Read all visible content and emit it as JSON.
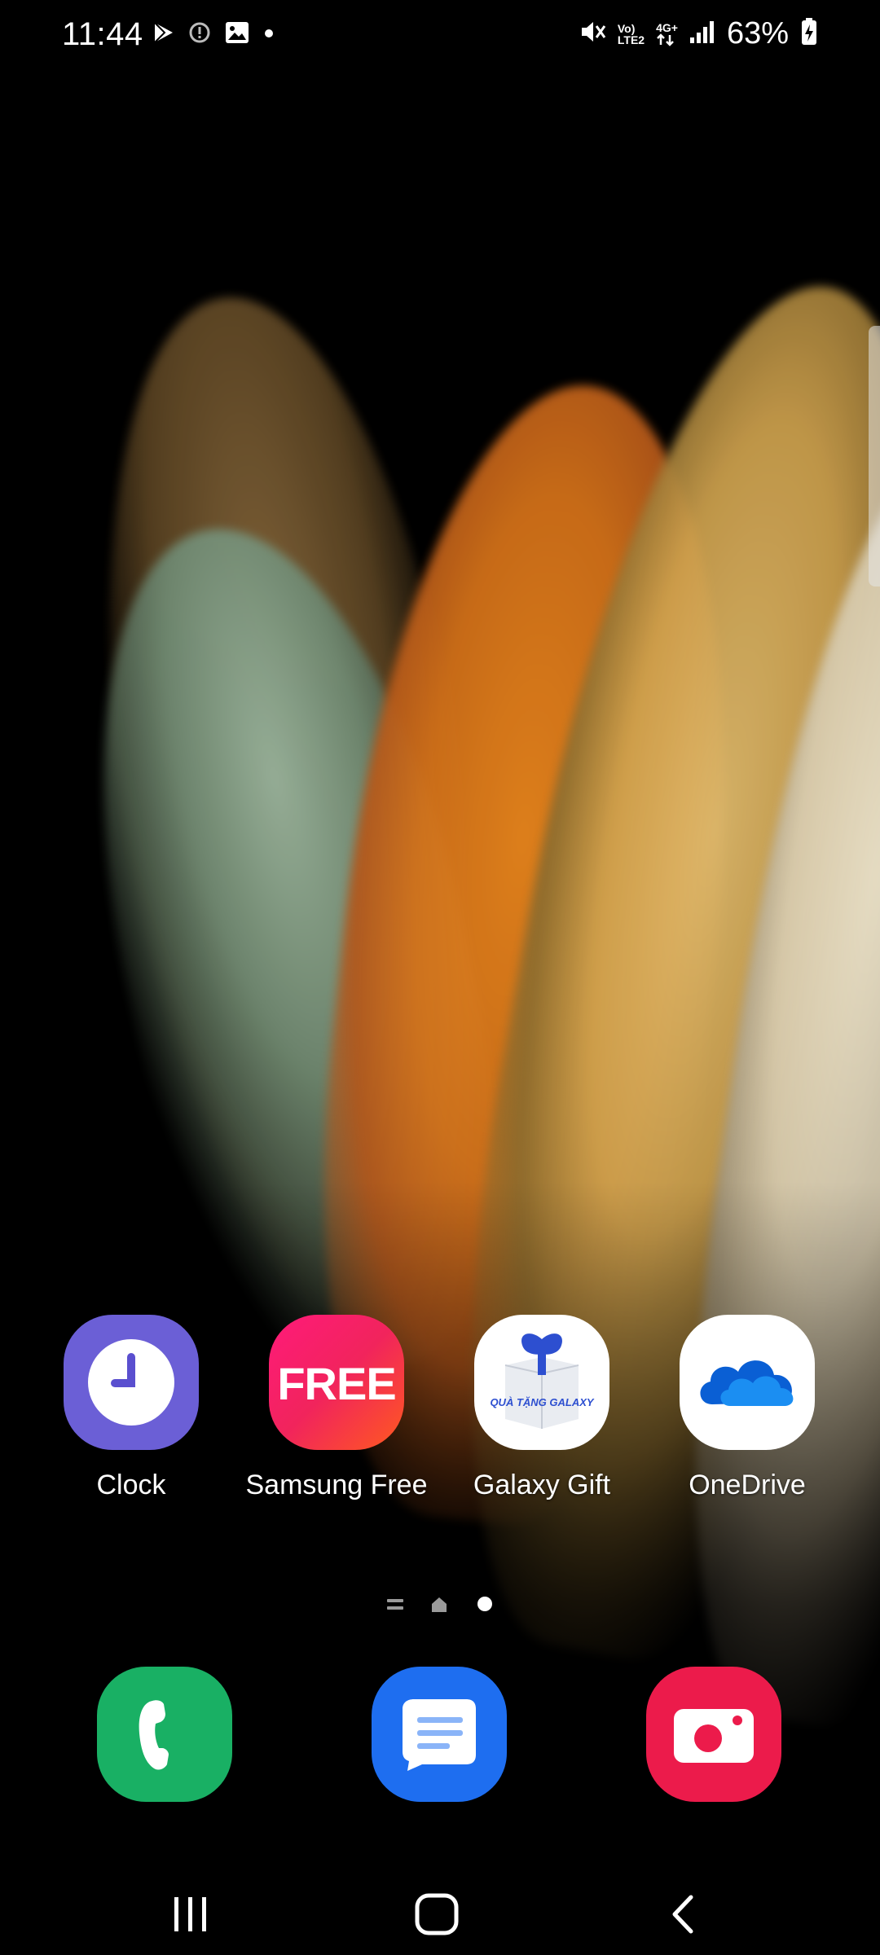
{
  "status_bar": {
    "time": "11:44",
    "notification_icons": [
      "play-store-icon",
      "alert-circle-icon",
      "image-icon",
      "dot-icon"
    ],
    "signal_label_top": "Vo)",
    "signal_label_bottom": "LTE2",
    "network_label": "4G+",
    "battery_percent": "63%",
    "status_icons": [
      "mute-icon",
      "volte-icon",
      "data-arrows-icon",
      "signal-bars-icon",
      "battery-charging-icon"
    ]
  },
  "home": {
    "apps": [
      {
        "label": "Clock",
        "icon": "clock-icon",
        "color": "#6b5fd6"
      },
      {
        "label": "Samsung Free",
        "icon": "samsung-free-icon",
        "color": "#f1245c",
        "icon_text": "FREE"
      },
      {
        "label": "Galaxy Gift",
        "icon": "gift-box-icon",
        "color": "#ffffff",
        "icon_text": "QUÀ TẶNG GALAXY"
      },
      {
        "label": "OneDrive",
        "icon": "onedrive-cloud-icon",
        "color": "#ffffff"
      }
    ],
    "page_indicator": [
      "pages-list-icon",
      "home-page-icon",
      "current-page-dot"
    ]
  },
  "dock": [
    {
      "icon": "phone-icon",
      "color": "#19b064"
    },
    {
      "icon": "messages-icon",
      "color": "#1e6ef0"
    },
    {
      "icon": "camera-icon",
      "color": "#ec1b4b"
    }
  ],
  "nav_bar": {
    "buttons": [
      "recent-apps-icon",
      "home-button-icon",
      "back-icon"
    ]
  }
}
